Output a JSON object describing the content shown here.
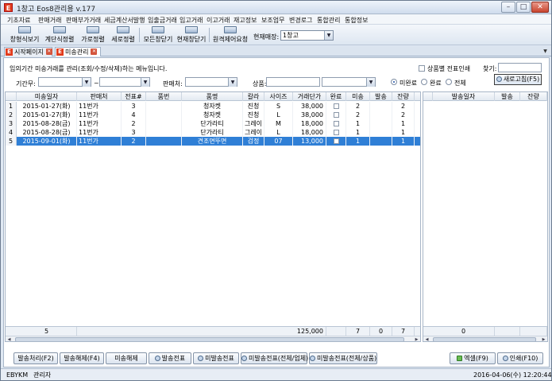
{
  "window": {
    "title": "1창고 Eos8관리용 v.177",
    "app_icon": "E",
    "buttons": [
      "minimize-icon",
      "maximize-icon",
      "close-icon"
    ]
  },
  "menu": [
    "기초자료",
    "판매거래",
    "판매부가거래",
    "세금계산서발행",
    "입출금거래",
    "입고거래",
    "이고거래",
    "재고정보",
    "보조업무",
    "변경로그",
    "통합관리",
    "통합정보"
  ],
  "toolbar": {
    "buttons": [
      "창형식보기",
      "계단식정렬",
      "가로정렬",
      "세로정렬",
      "모든창닫기",
      "현재창닫기",
      "원격제어요청"
    ],
    "store_label": "현재매장:",
    "store_value": "1창고"
  },
  "tabs": [
    {
      "label": "시작페이지",
      "active": false
    },
    {
      "label": "미송관리",
      "active": true
    }
  ],
  "filter": {
    "description": "임의기간 미송거래를 관리(조회/수정/삭제)하는 메뉴입니다.",
    "period_label": "기간무:",
    "period_separator": "~",
    "seller_label": "판매처:",
    "product_label": "상품:",
    "print_option": "상품별 전표인쇄",
    "search_label": "찾기:",
    "radio_options": [
      {
        "label": "미완료",
        "selected": true
      },
      {
        "label": "완료",
        "selected": false
      },
      {
        "label": "전체",
        "selected": false
      }
    ],
    "refresh_button": "새로고침(F5)"
  },
  "main_grid": {
    "columns": [
      "미송일자",
      "판매처",
      "전표#",
      "품번",
      "품명",
      "칼라",
      "사이즈",
      "거래단가",
      "완료",
      "미송",
      "발송",
      "잔량"
    ],
    "rows": [
      {
        "no": "1",
        "date": "2015-01-27(화)",
        "seller": "11번가",
        "slip": "3",
        "code": "",
        "name": "청자켓",
        "color": "진청",
        "size": "S",
        "price": "38,000",
        "done": false,
        "pending": "2",
        "shipped": "",
        "remain": "2"
      },
      {
        "no": "2",
        "date": "2015-01-27(화)",
        "seller": "11번가",
        "slip": "4",
        "code": "",
        "name": "청자켓",
        "color": "진청",
        "size": "L",
        "price": "38,000",
        "done": false,
        "pending": "2",
        "shipped": "",
        "remain": "2"
      },
      {
        "no": "3",
        "date": "2015-08-28(금)",
        "seller": "11번가",
        "slip": "2",
        "code": "",
        "name": "단가라티",
        "color": "그레이",
        "size": "M",
        "price": "18,000",
        "done": false,
        "pending": "1",
        "shipped": "",
        "remain": "1"
      },
      {
        "no": "4",
        "date": "2015-08-28(금)",
        "seller": "11번가",
        "slip": "3",
        "code": "",
        "name": "단가라티",
        "color": "그레이",
        "size": "L",
        "price": "18,000",
        "done": false,
        "pending": "1",
        "shipped": "",
        "remain": "1"
      },
      {
        "no": "5",
        "date": "2015-09-01(화)",
        "seller": "11번가",
        "slip": "2",
        "code": "",
        "name": "견조면뚜면",
        "color": "검정",
        "size": "07",
        "price": "13,000",
        "done": false,
        "pending": "1",
        "shipped": "",
        "remain": "1",
        "selected": true
      }
    ],
    "footer": {
      "count": "5",
      "price_total": "125,000",
      "pending_total": "7",
      "shipped_total": "0",
      "remain_total": "7"
    }
  },
  "side_grid": {
    "columns": [
      "발송일자",
      "발송",
      "잔량"
    ],
    "footer": {
      "count": "0"
    }
  },
  "bottom_buttons": [
    "발송처리(F2)",
    "발송해제(F4)",
    "미송해제",
    "발송전표",
    "미발송전표",
    "미발송전표(전체/업체)",
    "미발송전표(전체/상품)"
  ],
  "right_buttons": [
    "엑셀(F9)",
    "인쇄(F10)"
  ],
  "status": {
    "user_id": "EBYKM",
    "role": "관리자",
    "datetime": "2016-04-06(수) 12:20:44"
  }
}
